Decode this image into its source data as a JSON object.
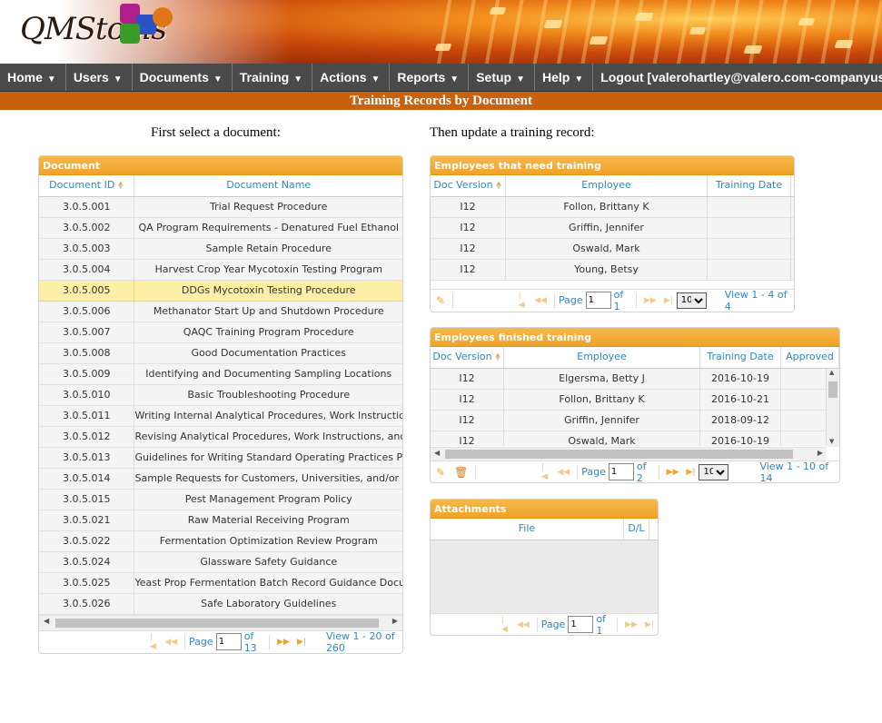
{
  "brand": {
    "logo_text": "QMStools"
  },
  "nav": {
    "items": [
      "Home",
      "Users",
      "Documents",
      "Training",
      "Actions",
      "Reports",
      "Setup",
      "Help"
    ],
    "logout": "Logout [valerohartley@valero.com-companyus"
  },
  "page_title": "Training Records by Document",
  "left_heading": "First select a document:",
  "right_heading": "Then update a training record:",
  "documents": {
    "caption": "Document",
    "col_id": "Document ID",
    "col_name": "Document Name",
    "rows": [
      {
        "id": "3.0.5.001",
        "name": "Trial Request Procedure"
      },
      {
        "id": "3.0.5.002",
        "name": "QA Program Requirements - Denatured Fuel Ethanol"
      },
      {
        "id": "3.0.5.003",
        "name": "Sample Retain Procedure"
      },
      {
        "id": "3.0.5.004",
        "name": "Harvest Crop Year Mycotoxin Testing Program"
      },
      {
        "id": "3.0.5.005",
        "name": "DDGs Mycotoxin Testing Procedure"
      },
      {
        "id": "3.0.5.006",
        "name": "Methanator Start Up and Shutdown Procedure"
      },
      {
        "id": "3.0.5.007",
        "name": "QAQC Training Program Procedure"
      },
      {
        "id": "3.0.5.008",
        "name": "Good Documentation Practices"
      },
      {
        "id": "3.0.5.009",
        "name": "Identifying and Documenting Sampling Locations"
      },
      {
        "id": "3.0.5.010",
        "name": "Basic Troubleshooting Procedure"
      },
      {
        "id": "3.0.5.011",
        "name": "Writing Internal Analytical Procedures, Work Instructions an"
      },
      {
        "id": "3.0.5.012",
        "name": "Revising Analytical Procedures, Work Instructions, and Docu"
      },
      {
        "id": "3.0.5.013",
        "name": "Guidelines for Writing Standard Operating Practices Procedu"
      },
      {
        "id": "3.0.5.014",
        "name": "Sample Requests for Customers, Universities, and/or Resea"
      },
      {
        "id": "3.0.5.015",
        "name": "Pest Management Program Policy"
      },
      {
        "id": "3.0.5.021",
        "name": "Raw Material Receiving Program"
      },
      {
        "id": "3.0.5.022",
        "name": "Fermentation Optimization Review Program"
      },
      {
        "id": "3.0.5.024",
        "name": "Glassware Safety Guidance"
      },
      {
        "id": "3.0.5.025",
        "name": "Yeast Prop Fermentation Batch Record Guidance Document"
      },
      {
        "id": "3.0.5.026",
        "name": "Safe Laboratory Guidelines"
      }
    ],
    "selected_index": 4,
    "pager": {
      "page_label": "Page",
      "page": "1",
      "of": "of 13",
      "view": "View 1 - 20 of 260"
    }
  },
  "need_training": {
    "caption": "Employees that need training",
    "col_ver": "Doc Version",
    "col_emp": "Employee",
    "col_date": "Training Date",
    "rows": [
      {
        "ver": "I12",
        "emp": "Follon, Brittany K",
        "date": ""
      },
      {
        "ver": "I12",
        "emp": "Griffin, Jennifer",
        "date": ""
      },
      {
        "ver": "I12",
        "emp": "Oswald, Mark",
        "date": ""
      },
      {
        "ver": "I12",
        "emp": "Young, Betsy",
        "date": ""
      }
    ],
    "pager": {
      "page_label": "Page",
      "page": "1",
      "of": "of 1",
      "rows_option": "10",
      "view": "View 1 - 4 of 4"
    }
  },
  "finished_training": {
    "caption": "Employees finished training",
    "col_ver": "Doc Version",
    "col_emp": "Employee",
    "col_date": "Training Date",
    "col_appr": "Approved",
    "rows": [
      {
        "ver": "I12",
        "emp": "Elgersma, Betty J",
        "date": "2016-10-19",
        "appr": ""
      },
      {
        "ver": "I12",
        "emp": "Follon, Brittany K",
        "date": "2016-10-21",
        "appr": ""
      },
      {
        "ver": "I12",
        "emp": "Griffin, Jennifer",
        "date": "2018-09-12",
        "appr": ""
      },
      {
        "ver": "I12",
        "emp": "Oswald, Mark",
        "date": "2016-10-19",
        "appr": ""
      }
    ],
    "pager": {
      "page_label": "Page",
      "page": "1",
      "of": "of 2",
      "rows_option": "10",
      "view": "View 1 - 10 of 14"
    }
  },
  "attachments": {
    "caption": "Attachments",
    "col_file": "File",
    "col_dl": "D/L",
    "pager": {
      "page_label": "Page",
      "page": "1",
      "of": "of 1"
    }
  },
  "colors": {
    "accent": "#f0a22a",
    "header_text": "#2e87c6",
    "nav_bg": "#4a4a4a",
    "subbar": "#c8620e",
    "selected_row": "#fdf0a6"
  }
}
